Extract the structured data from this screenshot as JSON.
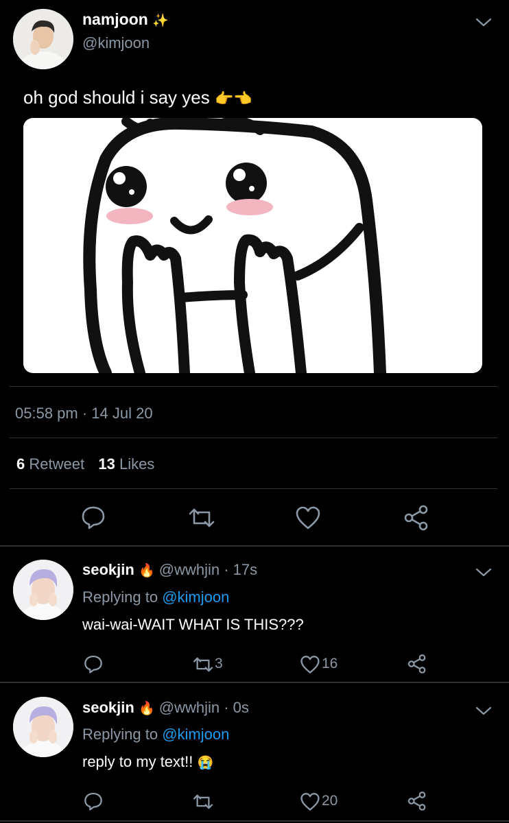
{
  "main_tweet": {
    "name": "namjoon",
    "name_emoji": "✨",
    "handle": "@kimjoon",
    "text": "oh god should i say yes",
    "text_emoji": "👉👈",
    "time": "05:58 pm",
    "date_sep": " · ",
    "date": "14 Jul 20",
    "retweets_count": "6",
    "retweets_label": "Retweet",
    "likes_count": "13",
    "likes_label": "Likes"
  },
  "replies": [
    {
      "name": "seokjin",
      "name_emoji": "🔥",
      "handle": "@wwhjin",
      "time": "· 17s",
      "replying_label": "Replying to",
      "replying_handle": "@kimjoon",
      "text": "wai-wai-WAIT WHAT IS THIS???",
      "retweet_count": "3",
      "like_count": "16"
    },
    {
      "name": "seokjin",
      "name_emoji": "🔥",
      "handle": "@wwhjin",
      "time": "· 0s",
      "replying_label": "Replying to",
      "replying_handle": "@kimjoon",
      "text": "reply to my text!!",
      "text_emoji": "😭",
      "retweet_count": "",
      "like_count": "20"
    }
  ],
  "icons": {
    "reply": "reply-icon",
    "retweet": "retweet-icon",
    "like": "heart-icon",
    "share": "share-icon",
    "more": "chevron-down-icon"
  },
  "colors": {
    "background": "#000000",
    "text": "#ffffff",
    "muted": "#8b98a5",
    "link": "#1d9bf0",
    "divider": "#2f3336"
  }
}
